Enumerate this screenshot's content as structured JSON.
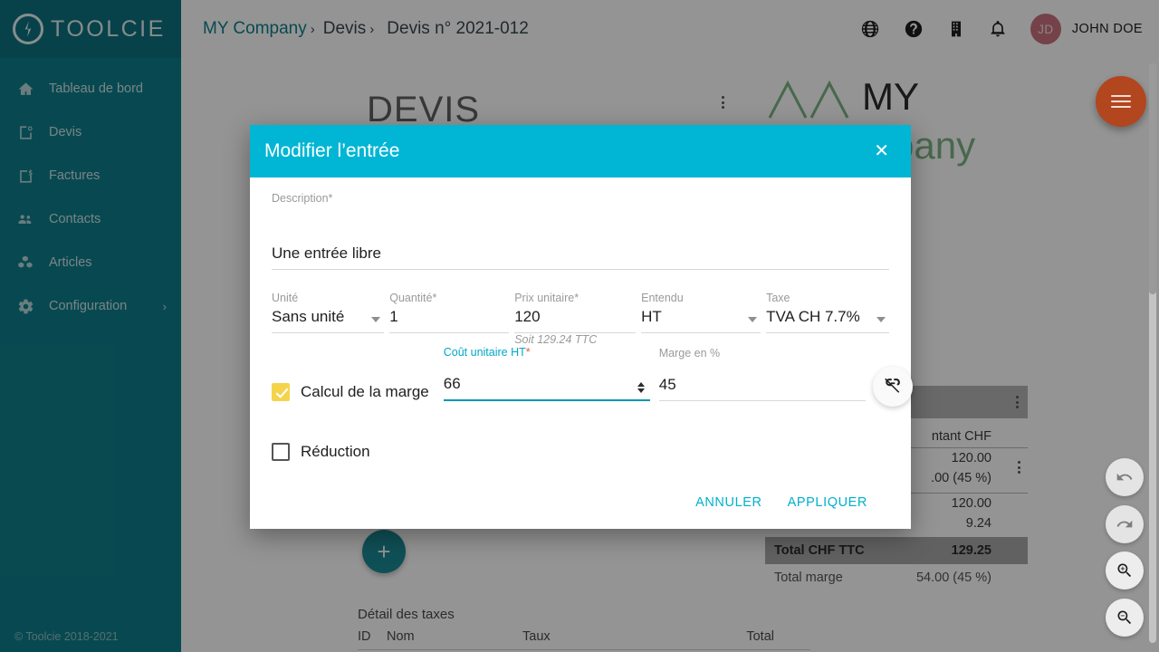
{
  "brand": {
    "name": "TOOLCIE",
    "logo_icon": "toolcie-logo-icon"
  },
  "sidebar": {
    "items": [
      {
        "label": "Tableau de bord",
        "icon": "home-icon",
        "chevron": ""
      },
      {
        "label": "Devis",
        "icon": "quote-document-icon",
        "chevron": ""
      },
      {
        "label": "Factures",
        "icon": "invoice-dollar-icon",
        "chevron": ""
      },
      {
        "label": "Contacts",
        "icon": "people-icon",
        "chevron": ""
      },
      {
        "label": "Articles",
        "icon": "cubes-icon",
        "chevron": ""
      },
      {
        "label": "Configuration",
        "icon": "gear-icon",
        "chevron": "›"
      }
    ],
    "footer": "© Toolcie 2018-2021"
  },
  "topbar": {
    "breadcrumb": [
      {
        "label": "MY Company",
        "sep": "›"
      },
      {
        "label": "Devis",
        "sep": "›"
      },
      {
        "label": "Devis n° 2021-012",
        "sep": ""
      }
    ],
    "icons": [
      "globe-icon",
      "help-circle-icon",
      "building-icon",
      "bell-icon"
    ],
    "user": {
      "initials": "JD",
      "name": "JOHN DOE"
    }
  },
  "document": {
    "title": "DEVIS",
    "company_word1": "MY",
    "company_word2": "pany",
    "add_button": "+",
    "taxes_title": "Détail des taxes",
    "taxes_columns": [
      "ID",
      "Nom",
      "Taux",
      "Total"
    ],
    "totals": {
      "amount_header": "ntant CHF",
      "rows": [
        {
          "label": "",
          "value": "120.00"
        },
        {
          "label": "",
          "value": ".00 (45 %)"
        },
        {
          "label": "",
          "value": "120.00"
        },
        {
          "label": "",
          "value": "9.24"
        }
      ],
      "total_label": "Total CHF TTC",
      "total_value": "129.25",
      "margin_label": "Total marge",
      "margin_value": "54.00 (45 %)"
    }
  },
  "rail": {
    "menu_icon": "hamburger-menu-icon",
    "undo_icon": "undo-arrow-icon",
    "redo_icon": "redo-arrow-icon",
    "zoom_in_icon": "zoom-in-icon",
    "zoom_out_icon": "zoom-out-icon"
  },
  "modal": {
    "title": "Modifier l’entrée",
    "close_icon": "close-icon",
    "description": {
      "label": "Description",
      "required_mark": "*",
      "value": "Une entrée libre"
    },
    "fields": [
      {
        "label": "Unité",
        "required_mark": "",
        "value": "Sans unité",
        "type": "select"
      },
      {
        "label": "Quantité",
        "required_mark": "*",
        "value": "1",
        "type": "text"
      },
      {
        "label": "Prix unitaire",
        "required_mark": "*",
        "value": "120",
        "type": "text",
        "hint": "Soit 129.24 TTC"
      },
      {
        "label": "Entendu",
        "required_mark": "",
        "value": "HT",
        "type": "select"
      },
      {
        "label": "Taxe",
        "required_mark": "",
        "value": "TVA CH 7.7%",
        "type": "select"
      }
    ],
    "margin": {
      "checkbox_label": "Calcul de la marge",
      "checked": true,
      "cost_label": "Coût unitaire HT",
      "cost_required_mark": "*",
      "cost_value": "66",
      "margin_label": "Marge en %",
      "margin_value": "45",
      "unlink_icon": "link-off-icon"
    },
    "reduction": {
      "label": "Réduction",
      "checked": false
    },
    "actions": {
      "cancel": "ANNULER",
      "apply": "APPLIQUER"
    }
  },
  "colors": {
    "sidebar": "#0f7f8c",
    "modal_header": "#00b6d4",
    "accent_teal": "#00b0cb",
    "checkbox_yellow": "#f5d44d",
    "fab_orange": "#b2461f",
    "required_red": "#e05a3c"
  }
}
